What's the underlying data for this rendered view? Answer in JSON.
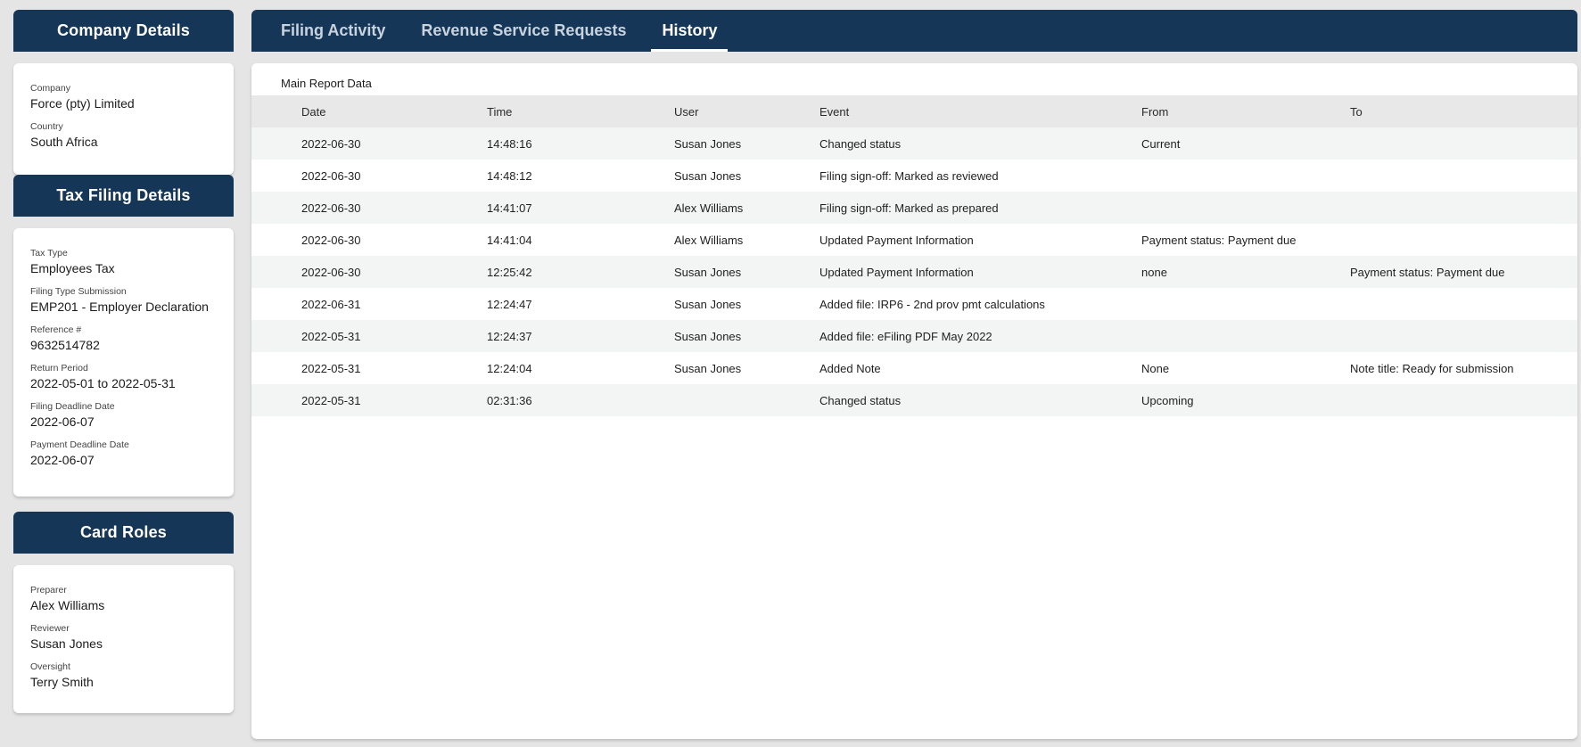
{
  "company_panel": {
    "title": "Company Details",
    "fields": [
      {
        "label": "Company",
        "value": "Force (pty) Limited"
      },
      {
        "label": "Country",
        "value": "South Africa"
      }
    ]
  },
  "tax_panel": {
    "title": "Tax Filing Details",
    "fields": [
      {
        "label": "Tax Type",
        "value": "Employees Tax"
      },
      {
        "label": "Filing Type Submission",
        "value": "EMP201 - Employer Declaration"
      },
      {
        "label": "Reference #",
        "value": "9632514782"
      },
      {
        "label": "Return Period",
        "value": "2022-05-01 to 2022-05-31"
      },
      {
        "label": "Filing Deadline Date",
        "value": "2022-06-07"
      },
      {
        "label": "Payment Deadline Date",
        "value": "2022-06-07"
      }
    ]
  },
  "roles_panel": {
    "title": "Card Roles",
    "fields": [
      {
        "label": "Preparer",
        "value": "Alex Williams"
      },
      {
        "label": "Reviewer",
        "value": "Susan Jones"
      },
      {
        "label": "Oversight",
        "value": "Terry Smith"
      }
    ]
  },
  "tabs": [
    {
      "label": "Filing Activity",
      "active": false
    },
    {
      "label": "Revenue Service Requests",
      "active": false
    },
    {
      "label": "History",
      "active": true
    }
  ],
  "report": {
    "title": "Main Report Data",
    "columns": [
      "Date",
      "Time",
      "User",
      "Event",
      "From",
      "To"
    ],
    "rows": [
      [
        "2022-06-30",
        "14:48:16",
        "Susan Jones",
        "Changed status",
        "Current",
        ""
      ],
      [
        "2022-06-30",
        "14:48:12",
        "Susan Jones",
        "Filing sign-off: Marked as reviewed",
        "",
        ""
      ],
      [
        "2022-06-30",
        "14:41:07",
        "Alex Williams",
        "Filing sign-off: Marked as prepared",
        "",
        ""
      ],
      [
        "2022-06-30",
        "14:41:04",
        "Alex Williams",
        "Updated Payment Information",
        "Payment status: Payment due",
        ""
      ],
      [
        "2022-06-30",
        "12:25:42",
        "Susan Jones",
        "Updated Payment Information",
        "none",
        "Payment status: Payment due"
      ],
      [
        "2022-06-31",
        "12:24:47",
        "Susan Jones",
        "Added file:  IRP6 - 2nd prov pmt calculations",
        "",
        ""
      ],
      [
        "2022-05-31",
        "12:24:37",
        "Susan Jones",
        "Added file:  eFiling PDF May 2022",
        "",
        ""
      ],
      [
        "2022-05-31",
        "12:24:04",
        "Susan Jones",
        "Added Note",
        "None",
        "Note title: Ready for submission"
      ],
      [
        "2022-05-31",
        "02:31:36",
        "",
        "Changed status",
        "Upcoming",
        ""
      ]
    ]
  },
  "colors": {
    "header_navy": "#153657",
    "background": "#e5e5e5",
    "row_stripe": "#f3f5f4",
    "table_header": "#e8e8e8"
  }
}
